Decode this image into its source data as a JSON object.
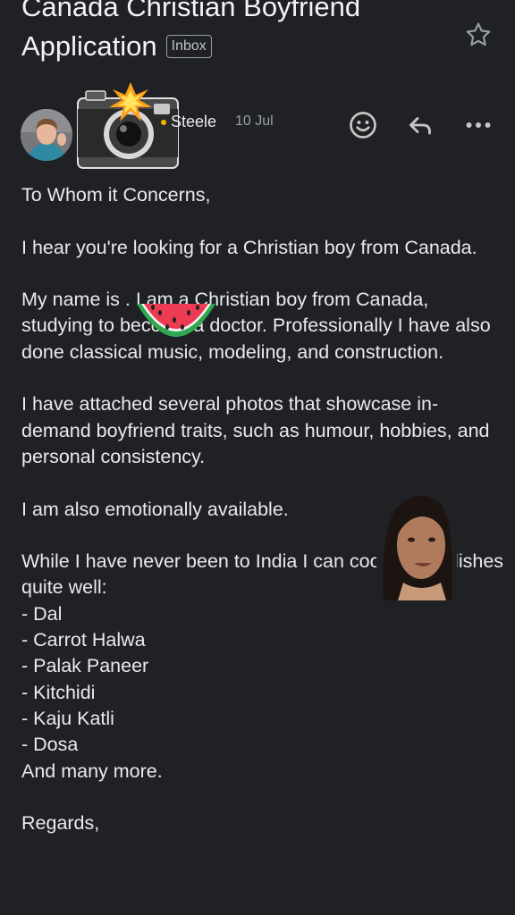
{
  "email": {
    "subject": "Canada Christian Boyfriend Application",
    "label": "Inbox",
    "sender_name": "Steele",
    "date": "10 Jul",
    "body": "To Whom it Concerns,\n\nI hear you're looking for a Christian boy from Canada.\n\nMy name is            . I am a Christian boy from Canada, studying to become a doctor. Professionally I have also done classical music, modeling, and construction.\n\nI have attached several photos that showcase in-demand boyfriend traits, such as humour, hobbies, and personal consistency.\n\nI am also emotionally available.\n\nWhile I have never been to India I can cook these dishes quite well:\n- Dal\n- Carrot Halwa\n- Palak Paneer\n- Kitchidi\n- Kaju Katli\n- Dosa\nAnd many more.\n\nRegards,"
  },
  "icons": {
    "star": "star-outline-icon",
    "emoji": "add-reaction-icon",
    "reply": "reply-icon",
    "more": "more-horizontal-icon",
    "camera_sticker": "camera-flash-emoji",
    "watermelon_sticker": "watermelon-emoji"
  },
  "colors": {
    "background": "#202124",
    "text": "#e8eaed",
    "secondary_text": "#9aa0a6",
    "dot": "#f4b400"
  }
}
